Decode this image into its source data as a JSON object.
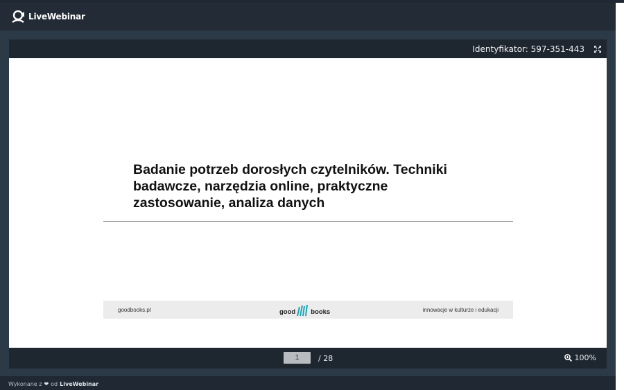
{
  "brand": {
    "name": "LiveWebinar"
  },
  "viewer": {
    "identifier": "Identyfikator: 597-351-443",
    "fullscreen_icon": "fullscreen-icon"
  },
  "slide": {
    "title": "Badanie potrzeb dorosłych czytelników. Techniki badawcze, narzędzia online, praktyczne zastosowanie, analiza danych",
    "footer": {
      "left": "goodbooks.pl",
      "logo_left": "good",
      "logo_right": "books",
      "right": "innowacje w kulturze i edukacji"
    }
  },
  "pager": {
    "current_page": "1",
    "total": "/ 28",
    "zoom": "100%"
  },
  "credit": {
    "prefix": "Wykonane z",
    "middle": "od",
    "brand": "LiveWebinar"
  },
  "colors": {
    "background": "#1f2833",
    "header": "#1e2630",
    "logo_teal": "#1aa6b7"
  }
}
